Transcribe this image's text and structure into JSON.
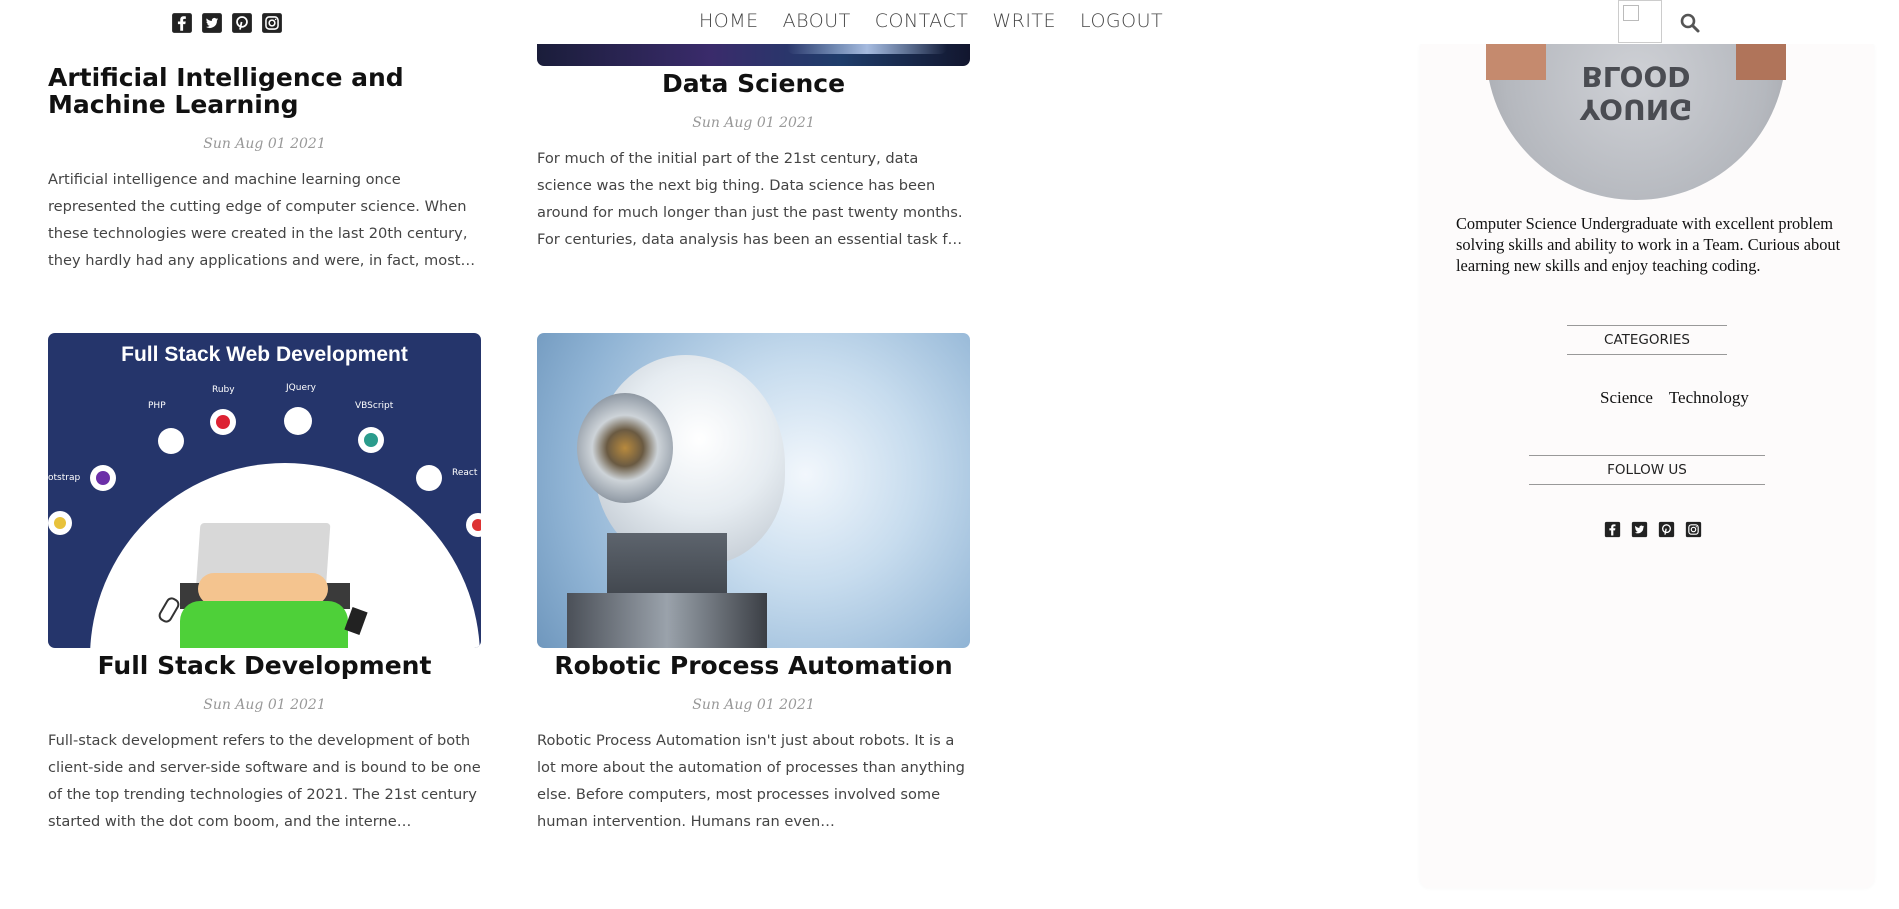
{
  "nav": {
    "items": [
      {
        "label": "HOME"
      },
      {
        "label": "ABOUT"
      },
      {
        "label": "CONTACT"
      },
      {
        "label": "WRITE"
      },
      {
        "label": "LOGOUT"
      }
    ]
  },
  "social_icons": [
    "facebook-square-icon",
    "twitter-square-icon",
    "pinterest-square-icon",
    "instagram-icon"
  ],
  "posts": [
    {
      "title": "Artificial Intelligence and Machine Learning",
      "date": "Sun Aug 01 2021",
      "excerpt": "Artificial intelligence and machine learning once represented the cutting edge of computer science. When these technologies were created in the last 20th century, they hardly had any applications and were, in fact, most…"
    },
    {
      "title": "Data Science",
      "date": "Sun Aug 01 2021",
      "excerpt": "For much of the initial part of the 21st century, data science was the next big thing. Data science has been around for much longer than just the past twenty months. For centuries, data analysis has been an essential task f…"
    },
    {
      "title": "Full Stack Development",
      "date": "Sun Aug 01 2021",
      "excerpt": "Full-stack development refers to the development of both client-side and server-side software and is bound to be one of the top trending technologies of 2021. The 21st century started with the dot com boom, and the interne…",
      "image": {
        "heading": "Full Stack Web Development",
        "tech_labels": [
          "PHP",
          "Ruby",
          "JQuery",
          "VBScript",
          "otstrap",
          "React"
        ]
      }
    },
    {
      "title": "Robotic Process Automation",
      "date": "Sun Aug 01 2021",
      "excerpt": "Robotic Process Automation isn't just about robots. It is a lot more about the automation of processes than anything else. Before computers, most processes involved some human intervention. Humans ran even…"
    }
  ],
  "sidebar": {
    "shirt_text": "YOUNG BLOOD",
    "bio": "Computer Science Undergraduate with excellent problem solving skills and ability to work in a Team. Curious about learning new skills and enjoy teaching coding.",
    "categories_title": "CATEGORIES",
    "categories": [
      "Science",
      "Technology"
    ],
    "follow_title": "FOLLOW US"
  },
  "colors": {
    "fs_bg": "#25356b",
    "robot_bg": "#bcd4e8",
    "sidebar_bg": "#fdfbfb"
  }
}
